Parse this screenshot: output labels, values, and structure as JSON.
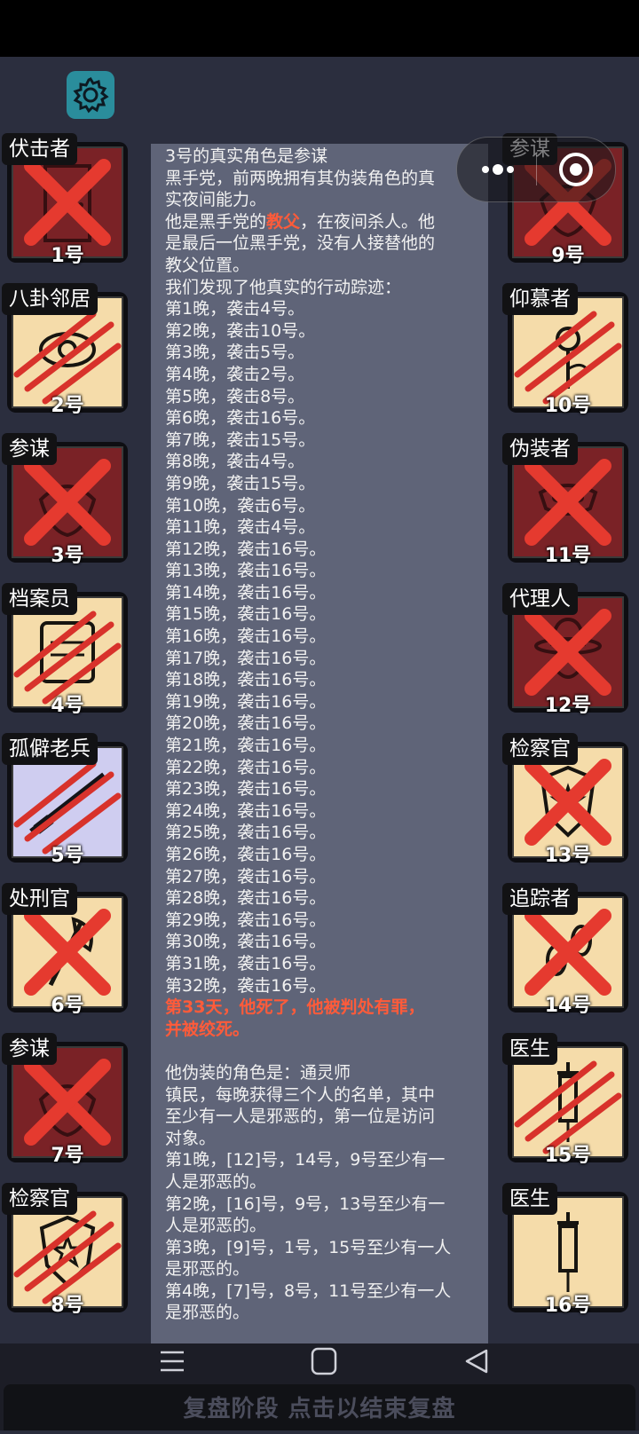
{
  "colors": {
    "accent": "#2a8d9c",
    "evil_card": "#7a2226",
    "good_card": "#f5dcaa",
    "veteran_card": "#cfcdf0",
    "highlight": "#ff5b3a"
  },
  "left_players": [
    {
      "role": "伏击者",
      "number": "1号",
      "team": "evil",
      "mark": "x",
      "icon": "door-icon"
    },
    {
      "role": "八卦邻居",
      "number": "2号",
      "team": "good",
      "mark": "claw",
      "icon": "eye-icon"
    },
    {
      "role": "参谋",
      "number": "3号",
      "team": "evil",
      "mark": "x",
      "icon": "mask-icon"
    },
    {
      "role": "档案员",
      "number": "4号",
      "team": "good",
      "mark": "claw",
      "icon": "scroll-icon"
    },
    {
      "role": "孤僻老兵",
      "number": "5号",
      "team": "veteran",
      "mark": "claw",
      "icon": "rifle-icon"
    },
    {
      "role": "处刑官",
      "number": "6号",
      "team": "good",
      "mark": "x",
      "icon": "axe-icon"
    },
    {
      "role": "参谋",
      "number": "7号",
      "team": "evil",
      "mark": "x",
      "icon": "mask-icon"
    },
    {
      "role": "检察官",
      "number": "8号",
      "team": "good",
      "mark": "claw",
      "icon": "badge-icon"
    }
  ],
  "right_players": [
    {
      "role": "参谋",
      "number": "9号",
      "team": "evil",
      "mark": "x",
      "icon": "mask-icon"
    },
    {
      "role": "仰慕者",
      "number": "10号",
      "team": "good",
      "mark": "claw",
      "icon": "flower-icon"
    },
    {
      "role": "伪装者",
      "number": "11号",
      "team": "evil",
      "mark": "x",
      "icon": "disguise-icon"
    },
    {
      "role": "代理人",
      "number": "12号",
      "team": "evil",
      "mark": "x",
      "icon": "hat-icon"
    },
    {
      "role": "检察官",
      "number": "13号",
      "team": "good",
      "mark": "x",
      "icon": "badge-icon"
    },
    {
      "role": "追踪者",
      "number": "14号",
      "team": "good",
      "mark": "x",
      "icon": "footprint-icon"
    },
    {
      "role": "医生",
      "number": "15号",
      "team": "good",
      "mark": "claw",
      "icon": "syringe-icon"
    },
    {
      "role": "医生",
      "number": "16号",
      "team": "good",
      "mark": "none",
      "icon": "syringe-icon"
    }
  ],
  "log": {
    "line_01": "3号的真实角色是参谋",
    "line_02": "黑手党，前两晚拥有其伪装角色的真",
    "line_03": "实夜间能力。",
    "line_04_pre": "他是黑手党的",
    "line_04_hl": "教父",
    "line_04_post": "，在夜间杀人。他",
    "line_05": "是最后一位黑手党，没有人接替他的",
    "line_06": "教父位置。",
    "line_07": "我们发现了他真实的行动踪迹：",
    "attacks": [
      "第1晚，袭击4号。",
      "第2晚，袭击10号。",
      "第3晚，袭击5号。",
      "第4晚，袭击2号。",
      "第5晚，袭击8号。",
      "第6晚，袭击16号。",
      "第7晚，袭击15号。",
      "第8晚，袭击4号。",
      "第9晚，袭击15号。",
      "第10晚，袭击6号。",
      "第11晚，袭击4号。",
      "第12晚，袭击16号。",
      "第13晚，袭击16号。",
      "第14晚，袭击16号。",
      "第15晚，袭击16号。",
      "第16晚，袭击16号。",
      "第17晚，袭击16号。",
      "第18晚，袭击16号。",
      "第19晚，袭击16号。",
      "第20晚，袭击16号。",
      "第21晚，袭击16号。",
      "第22晚，袭击16号。",
      "第23晚，袭击16号。",
      "第24晚，袭击16号。",
      "第25晚，袭击16号。",
      "第26晚，袭击16号。",
      "第27晚，袭击16号。",
      "第28晚，袭击16号。",
      "第29晚，袭击16号。",
      "第30晚，袭击16号。",
      "第31晚，袭击16号。",
      "第32晚，袭击16号。"
    ],
    "death_1": "第33天，他死了，他被判处有罪，",
    "death_2": "并被绞死。",
    "disguise_1": "他伪装的角色是：通灵师",
    "disguise_2": "镇民，每晚获得三个人的名单，其中",
    "disguise_3": "至少有一人是邪恶的，第一位是访问",
    "disguise_4": "对象。",
    "night_1a": "第1晚，[12]号，14号，9号至少有一",
    "night_1b": "人是邪恶的。",
    "night_2a": "第2晚，[16]号，9号，13号至少有一",
    "night_2b": "人是邪恶的。",
    "night_3a": "第3晚，[9]号，1号，15号至少有一人",
    "night_3b": "是邪恶的。",
    "night_4a": "第4晚，[7]号，8号，11号至少有一人",
    "night_4b": "是邪恶的。"
  },
  "footer": {
    "end_review_label": "复盘阶段 点击以结束复盘"
  }
}
